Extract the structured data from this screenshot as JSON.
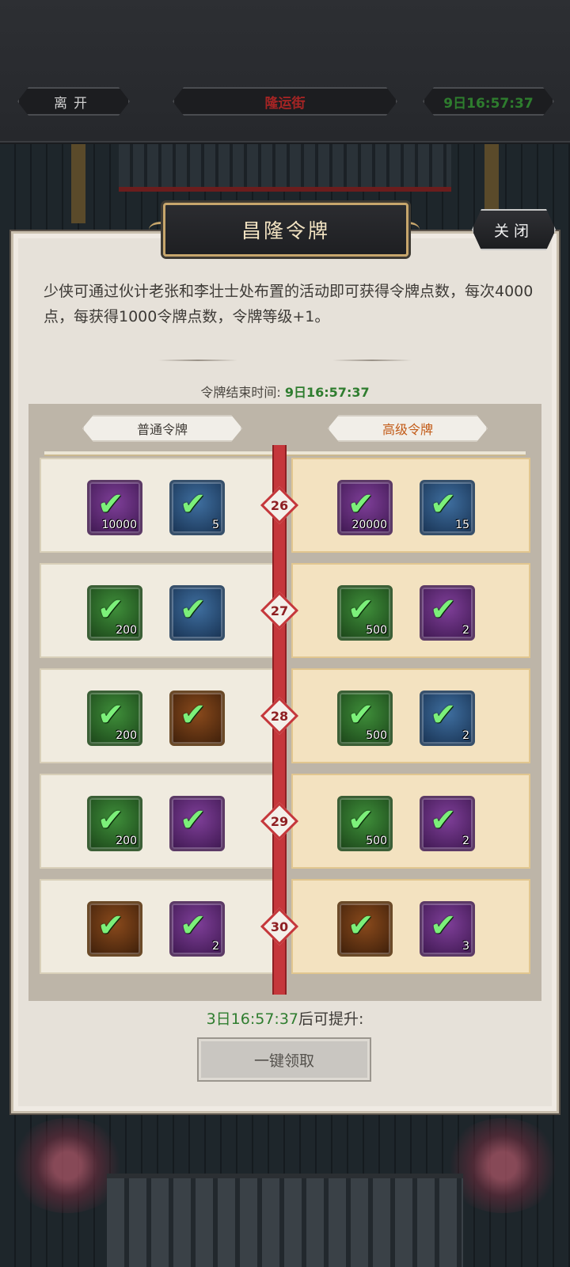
{
  "topbar": {
    "leave_label": "离开",
    "location_label": "隆运街",
    "clock_label": "9日16:57:37"
  },
  "dialog": {
    "title": "昌隆令牌",
    "close_label": "关闭",
    "description": "少侠可通过伙计老张和李壮士处布置的活动即可获得令牌点数，每次4000点，每获得1000令牌点数，令牌等级+1。",
    "end_time_label": "令牌结束时间:",
    "end_time_value": "9日16:57:37",
    "tabs": {
      "normal": "普通令牌",
      "premium": "高级令牌"
    },
    "rows": [
      {
        "level": "26",
        "normal": [
          {
            "icon": "gold-ingot-icon",
            "frame": "purple",
            "qty": "10000"
          },
          {
            "icon": "red-orb-icon",
            "frame": "blue",
            "qty": "5"
          }
        ],
        "premium": [
          {
            "icon": "gold-ingot-icon",
            "frame": "purple",
            "qty": "20000"
          },
          {
            "icon": "red-orb-icon",
            "frame": "blue",
            "qty": "15"
          }
        ]
      },
      {
        "level": "27",
        "normal": [
          {
            "icon": "scroll-icon",
            "frame": "green",
            "qty": "200"
          },
          {
            "icon": "green-gem-icon",
            "frame": "blue",
            "qty": ""
          }
        ],
        "premium": [
          {
            "icon": "scroll-icon",
            "frame": "green",
            "qty": "500"
          },
          {
            "icon": "purple-orb-icon",
            "frame": "purple",
            "qty": "2"
          }
        ]
      },
      {
        "level": "28",
        "normal": [
          {
            "icon": "scroll-icon",
            "frame": "green",
            "qty": "200"
          },
          {
            "icon": "jade-token-icon",
            "frame": "orange",
            "qty": ""
          }
        ],
        "premium": [
          {
            "icon": "scroll-icon",
            "frame": "green",
            "qty": "500"
          },
          {
            "icon": "pearl-icon",
            "frame": "blue",
            "qty": "2"
          }
        ]
      },
      {
        "level": "29",
        "normal": [
          {
            "icon": "scroll-icon",
            "frame": "green",
            "qty": "200"
          },
          {
            "icon": "blade-icon",
            "frame": "purple",
            "qty": ""
          }
        ],
        "premium": [
          {
            "icon": "scroll-icon",
            "frame": "green",
            "qty": "500"
          },
          {
            "icon": "golden-armor-icon",
            "frame": "purple",
            "qty": "2"
          }
        ]
      },
      {
        "level": "30",
        "normal": [
          {
            "icon": "green-chest-icon",
            "frame": "orange",
            "qty": ""
          },
          {
            "icon": "silver-orb-icon",
            "frame": "purple",
            "qty": "2"
          }
        ],
        "premium": [
          {
            "icon": "purple-chest-icon",
            "frame": "orange",
            "qty": ""
          },
          {
            "icon": "silver-orb-icon",
            "frame": "purple",
            "qty": "3"
          }
        ]
      }
    ],
    "upgrade_time": "3日16:57:37",
    "upgrade_suffix": "后可提升:",
    "claim_all_label": "一键领取",
    "claimed_mark": "✔"
  }
}
